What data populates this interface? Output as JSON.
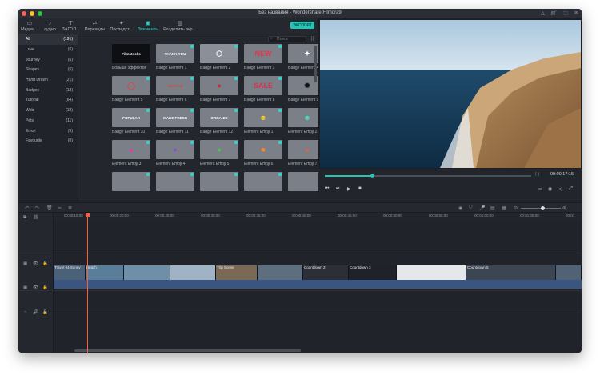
{
  "window": {
    "title": "Без названия - Wondershare Filmora9"
  },
  "traffic_lights": {
    "close_color": "#ff5f57",
    "min_color": "#febc2e",
    "max_color": "#28c840"
  },
  "titlebar_icons": [
    "△",
    "🛒",
    "⬚",
    "✉"
  ],
  "toolbar": {
    "tabs": [
      {
        "label": "Медиа...",
        "icon": "folder-icon"
      },
      {
        "label": "аудио",
        "icon": "music-note-icon"
      },
      {
        "label": "ЗАГОЛ...",
        "icon": "text-icon"
      },
      {
        "label": "Переходы",
        "icon": "transition-icon"
      },
      {
        "label": "Последст...",
        "icon": "effects-icon"
      },
      {
        "label": "Элементы",
        "icon": "elements-icon",
        "active": true
      },
      {
        "label": "Разделить экр...",
        "icon": "split-screen-icon"
      }
    ],
    "tab_glyphs": [
      "▭",
      "♪",
      "T",
      "⇄",
      "✦",
      "▣",
      "▥"
    ],
    "export_label": "ЭКСПОРТ"
  },
  "sidebar": {
    "items": [
      {
        "label": "All",
        "count": "(191)"
      },
      {
        "label": "Love",
        "count": "(6)"
      },
      {
        "label": "Journey",
        "count": "(6)"
      },
      {
        "label": "Shapes",
        "count": "(6)"
      },
      {
        "label": "Hand Drawn",
        "count": "(21)"
      },
      {
        "label": "Badges",
        "count": "(13)"
      },
      {
        "label": "Tutorial",
        "count": "(64)"
      },
      {
        "label": "Web",
        "count": "(18)"
      },
      {
        "label": "Pets",
        "count": "(11)"
      },
      {
        "label": "Emoji",
        "count": "(9)"
      },
      {
        "label": "Favourite",
        "count": "(0)"
      }
    ]
  },
  "search": {
    "placeholder": "Поиск"
  },
  "elements": [
    {
      "label": "Больше эффектов",
      "text": "Filmstocks",
      "bg": "#0e0f12",
      "fg": "#ffffff"
    },
    {
      "label": "Badge Element 1",
      "text": "THANK YOU",
      "bg": "#7a7f88",
      "fg": "#ffffff"
    },
    {
      "label": "Badge Element 2",
      "text": "⬡",
      "bg": "#8a8f98",
      "fg": "#ffffff"
    },
    {
      "label": "Badge Element 3",
      "text": "NEW",
      "bg": "#7a7f88",
      "fg": "#e8344d"
    },
    {
      "label": "Badge Element 4",
      "text": "✦",
      "bg": "#7a7f88",
      "fg": "#ffffff"
    },
    {
      "label": "Badge Element 5",
      "text": "◯",
      "bg": "#7a7f88",
      "fg": "#d94a3a"
    },
    {
      "label": "Badge Element 6",
      "text": "VINTAGE",
      "bg": "#7a7f88",
      "fg": "#d9473c"
    },
    {
      "label": "Badge Element 7",
      "text": "●",
      "bg": "#7a7f88",
      "fg": "#c3272f"
    },
    {
      "label": "Badge Element 8",
      "text": "SALE",
      "bg": "#7a7f88",
      "fg": "#d8344d"
    },
    {
      "label": "Badge Element 9",
      "text": "✹",
      "bg": "#7a7f88",
      "fg": "#111111"
    },
    {
      "label": "Badge Element 10",
      "text": "POPULAR",
      "bg": "#7a7f88",
      "fg": "#ffffff"
    },
    {
      "label": "Badge Element 11",
      "text": "MADE FRESH",
      "bg": "#7a7f88",
      "fg": "#ffffff"
    },
    {
      "label": "Badge Element 12",
      "text": "ORGANIC",
      "bg": "#7a7f88",
      "fg": "#ffffff"
    },
    {
      "label": "Element Emoji 1",
      "text": "☻",
      "bg": "#7a7f88",
      "fg": "#f5d020"
    },
    {
      "label": "Element Emoji 2",
      "text": "☻",
      "bg": "#7a7f88",
      "fg": "#4fd8c0"
    },
    {
      "label": "Element Emoji 3",
      "text": "▲",
      "bg": "#7a7f88",
      "fg": "#e23fa0"
    },
    {
      "label": "Element Emoji 4",
      "text": "●",
      "bg": "#7a7f88",
      "fg": "#8a4fd1"
    },
    {
      "label": "Element Emoji 5",
      "text": "●",
      "bg": "#7a7f88",
      "fg": "#4cc65a"
    },
    {
      "label": "Element Emoji 6",
      "text": "■",
      "bg": "#7a7f88",
      "fg": "#f08a24"
    },
    {
      "label": "Element Emoji 7",
      "text": "●",
      "bg": "#7a7f88",
      "fg": "#e3672d"
    },
    {
      "label": "",
      "text": "",
      "bg": "#7a7f88",
      "fg": "#ffffff"
    },
    {
      "label": "",
      "text": "",
      "bg": "#7a7f88",
      "fg": "#ffffff"
    },
    {
      "label": "",
      "text": "",
      "bg": "#7a7f88",
      "fg": "#ffffff"
    },
    {
      "label": "",
      "text": "",
      "bg": "#7a7f88",
      "fg": "#ffffff"
    },
    {
      "label": "",
      "text": "",
      "bg": "#7a7f88",
      "fg": "#ffffff"
    }
  ],
  "player": {
    "timecode": "00:00:17:15",
    "progress": 0.23,
    "brackets": "{  }"
  },
  "timeline": {
    "ruler": [
      "00:00:15:00",
      "00:00:20:00",
      "00:00:25:00",
      "00:00:30:00",
      "00:00:35:00",
      "00:00:40:00",
      "00:00:45:00",
      "00:00:50:00",
      "00:00:55:00",
      "00:01:00:00",
      "00:01:05:00",
      "00:01"
    ],
    "clips": [
      {
        "label": "Travel 04 Sunny",
        "color": "#4a6178"
      },
      {
        "label": "Beach",
        "color": "#5a7d9a"
      },
      {
        "label": "",
        "color": "#6f8fa8"
      },
      {
        "label": "",
        "color": "#9fb3c4"
      },
      {
        "label": "Trip Scene",
        "color": "#7a6a55"
      },
      {
        "label": "",
        "color": "#5d6f7e"
      },
      {
        "label": "Countdown 2",
        "color": "#2c2f36"
      },
      {
        "label": "Countdown 3",
        "color": "#1f2228"
      },
      {
        "label": "",
        "color": "#e6e7ea"
      },
      {
        "label": "Countdown 5",
        "color": "#3c4552"
      },
      {
        "label": "",
        "color": "#506273"
      }
    ]
  }
}
